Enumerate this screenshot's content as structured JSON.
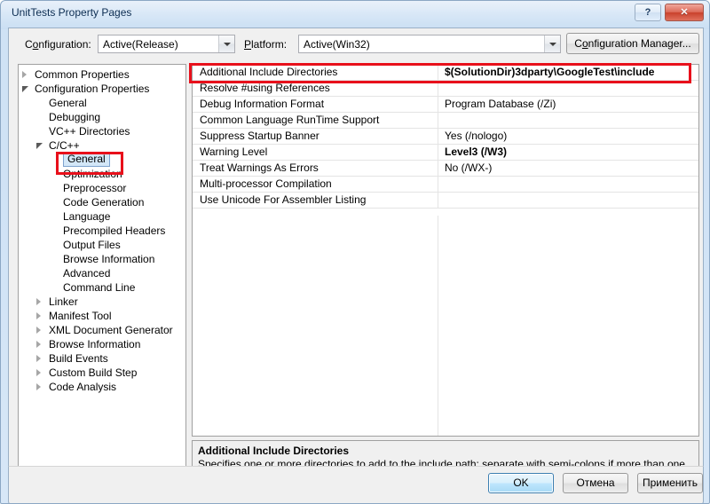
{
  "window": {
    "title": "UnitTests Property Pages",
    "help_button": "?",
    "close_button": "✕",
    "help_icon": "question-mark-icon",
    "close_icon": "close-x-icon"
  },
  "toolbar": {
    "configuration_label_pre": "C",
    "configuration_label_accel": "o",
    "configuration_label_post": "nfiguration:",
    "configuration_label": "Configuration:",
    "configuration_value": "Active(Release)",
    "platform_label": "Platform:",
    "platform_value": "Active(Win32)",
    "configuration_manager_button": "Configuration Manager...",
    "dropdown_icon": "chevron-down-icon"
  },
  "tree": {
    "items": [
      {
        "label": "Common Properties",
        "indent": 0,
        "twisty": "collapsed",
        "selected": false
      },
      {
        "label": "Configuration Properties",
        "indent": 0,
        "twisty": "expanded",
        "selected": false
      },
      {
        "label": "General",
        "indent": 1,
        "twisty": "none",
        "selected": false
      },
      {
        "label": "Debugging",
        "indent": 1,
        "twisty": "none",
        "selected": false
      },
      {
        "label": "VC++ Directories",
        "indent": 1,
        "twisty": "none",
        "selected": false
      },
      {
        "label": "C/C++",
        "indent": 1,
        "twisty": "expanded",
        "selected": false
      },
      {
        "label": "General",
        "indent": 2,
        "twisty": "none",
        "selected": true
      },
      {
        "label": "Optimization",
        "indent": 2,
        "twisty": "none",
        "selected": false
      },
      {
        "label": "Preprocessor",
        "indent": 2,
        "twisty": "none",
        "selected": false
      },
      {
        "label": "Code Generation",
        "indent": 2,
        "twisty": "none",
        "selected": false
      },
      {
        "label": "Language",
        "indent": 2,
        "twisty": "none",
        "selected": false
      },
      {
        "label": "Precompiled Headers",
        "indent": 2,
        "twisty": "none",
        "selected": false
      },
      {
        "label": "Output Files",
        "indent": 2,
        "twisty": "none",
        "selected": false
      },
      {
        "label": "Browse Information",
        "indent": 2,
        "twisty": "none",
        "selected": false
      },
      {
        "label": "Advanced",
        "indent": 2,
        "twisty": "none",
        "selected": false
      },
      {
        "label": "Command Line",
        "indent": 2,
        "twisty": "none",
        "selected": false
      },
      {
        "label": "Linker",
        "indent": 1,
        "twisty": "collapsed",
        "selected": false
      },
      {
        "label": "Manifest Tool",
        "indent": 1,
        "twisty": "collapsed",
        "selected": false
      },
      {
        "label": "XML Document Generator",
        "indent": 1,
        "twisty": "collapsed",
        "selected": false
      },
      {
        "label": "Browse Information",
        "indent": 1,
        "twisty": "collapsed",
        "selected": false
      },
      {
        "label": "Build Events",
        "indent": 1,
        "twisty": "collapsed",
        "selected": false
      },
      {
        "label": "Custom Build Step",
        "indent": 1,
        "twisty": "collapsed",
        "selected": false
      },
      {
        "label": "Code Analysis",
        "indent": 1,
        "twisty": "collapsed",
        "selected": false
      }
    ],
    "scrollbar": {
      "left_arrow_icon": "scroll-left-arrow-icon",
      "right_arrow_icon": "scroll-right-arrow-icon",
      "grip_icon": "scrollbar-grip-icon"
    }
  },
  "grid": {
    "rows": [
      {
        "name": "Additional Include Directories",
        "value": "$(SolutionDir)3dparty\\GoogleTest\\include",
        "bold": true,
        "highlighted": true
      },
      {
        "name": "Resolve #using References",
        "value": "",
        "bold": false,
        "highlighted": false
      },
      {
        "name": "Debug Information Format",
        "value": "Program Database (/Zi)",
        "bold": false,
        "highlighted": false
      },
      {
        "name": "Common Language RunTime Support",
        "value": "",
        "bold": false,
        "highlighted": false
      },
      {
        "name": "Suppress Startup Banner",
        "value": "Yes (/nologo)",
        "bold": false,
        "highlighted": false
      },
      {
        "name": "Warning Level",
        "value": "Level3 (/W3)",
        "bold": true,
        "highlighted": false
      },
      {
        "name": "Treat Warnings As Errors",
        "value": "No (/WX-)",
        "bold": false,
        "highlighted": false
      },
      {
        "name": "Multi-processor Compilation",
        "value": "",
        "bold": false,
        "highlighted": false
      },
      {
        "name": "Use Unicode For Assembler Listing",
        "value": "",
        "bold": false,
        "highlighted": false
      }
    ]
  },
  "description": {
    "title": "Additional Include Directories",
    "body": "Specifies one or more directories to add to the include path; separate with semi-colons if more than one. (/I[path])"
  },
  "buttons": {
    "ok": "OK",
    "cancel": "Отмена",
    "apply": "Применить"
  },
  "annotations": {
    "highlight_color": "#e8101b",
    "boxes": [
      "tree-item-general",
      "grid-row-additional-include-directories"
    ]
  }
}
